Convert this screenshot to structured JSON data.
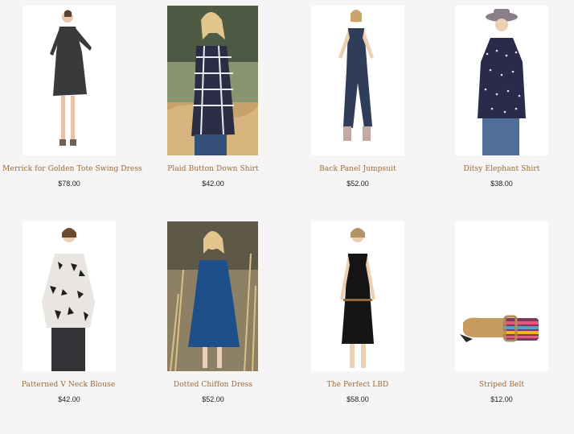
{
  "products": [
    {
      "name": "Merrick for Golden Tote Swing Dress",
      "price": "$78.00",
      "image_icon": "model-gray-swing-dress"
    },
    {
      "name": "Plaid Button Down Shirt",
      "price": "$42.00",
      "image_icon": "model-plaid-shirt-outdoor"
    },
    {
      "name": "Back Panel Jumpsuit",
      "price": "$52.00",
      "image_icon": "model-navy-jumpsuit"
    },
    {
      "name": "Ditsy Elephant Shirt",
      "price": "$38.00",
      "image_icon": "model-print-shirt-hat"
    },
    {
      "name": "Patterned V Neck Blouse",
      "price": "$42.00",
      "image_icon": "model-patterned-blouse"
    },
    {
      "name": "Dotted Chiffon Dress",
      "price": "$52.00",
      "image_icon": "model-blue-dress-outdoor"
    },
    {
      "name": "The Perfect LBD",
      "price": "$58.00",
      "image_icon": "model-black-dress"
    },
    {
      "name": "Striped Belt",
      "price": "$12.00",
      "image_icon": "striped-belt"
    }
  ]
}
